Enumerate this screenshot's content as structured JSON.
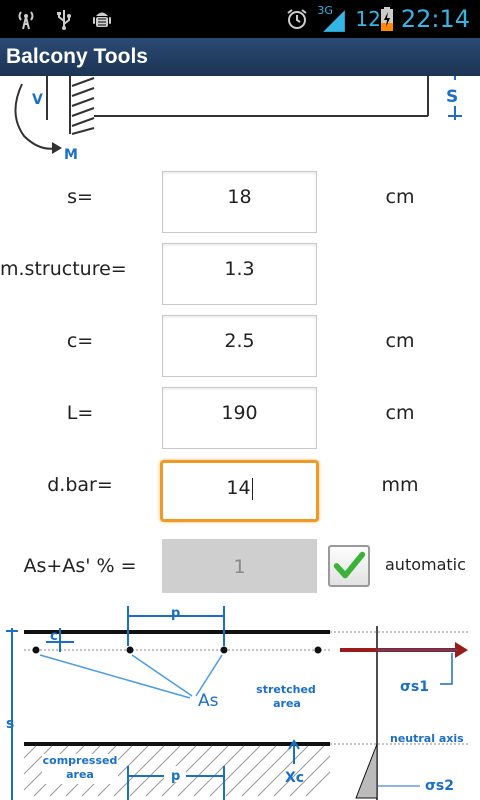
{
  "status_bar": {
    "network_type": "3G",
    "battery_level": "12",
    "time": "22:14",
    "icons": [
      "signal-tower-icon",
      "usb-icon",
      "android-debug-icon",
      "alarm-clock-icon",
      "cell-signal-icon",
      "battery-charging-icon"
    ]
  },
  "app_bar": {
    "title": "Balcony Tools"
  },
  "beam_diagram": {
    "label_v": "V",
    "label_m": "M",
    "label_s": "S"
  },
  "form": {
    "rows": [
      {
        "label": "s=",
        "value": "18",
        "unit": "cm"
      },
      {
        "label": "m.structure=",
        "value": "1.3",
        "unit": ""
      },
      {
        "label": "c=",
        "value": "2.5",
        "unit": "cm"
      },
      {
        "label": "L=",
        "value": "190",
        "unit": "cm"
      },
      {
        "label": "d.bar=",
        "value": "14",
        "unit": "mm"
      }
    ],
    "as_row": {
      "label": "As+As' % =",
      "value": "1",
      "checkbox_label": "automatic",
      "checked": true
    }
  },
  "section_diagram": {
    "label_c": "c",
    "label_p_top": "p",
    "label_as": "As",
    "label_stretched": "stretched",
    "label_area": "area",
    "label_sigma_s1": "σs1",
    "label_s": "s",
    "label_neutral_axis": "neutral axis",
    "label_compressed": "compressed",
    "label_area2": "area",
    "label_p_bottom": "p",
    "label_xc": "Xc",
    "label_sigma_s2": "σs2"
  },
  "colors": {
    "accent": "#33b5e5",
    "title_bar": "#203a5e",
    "focus": "#f09a26",
    "diagram_blue": "#1a6fc9",
    "check_green": "#3bb33b"
  }
}
